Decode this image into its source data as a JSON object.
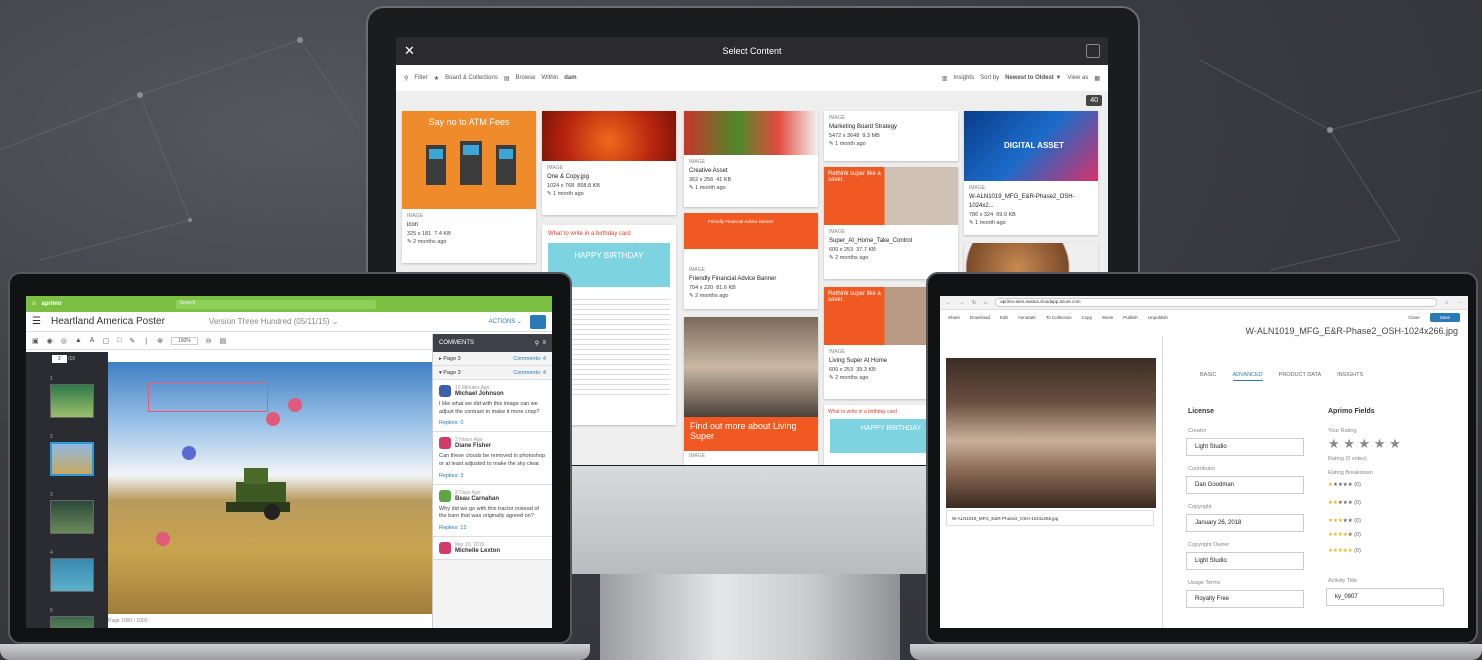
{
  "monitor": {
    "title": "Select Content",
    "close": "✕",
    "toolbar": {
      "filter": "Filter",
      "boards": "Board & Collections",
      "browse": "Browse",
      "within_label": "Within",
      "within": "dam",
      "insights": "Insights",
      "sort_label": "Sort by",
      "sort_value": "Newest to Oldest ▼",
      "view": "View as"
    },
    "count": "40",
    "cards": [
      {
        "banner": "Say no to ATM Fees",
        "type": "IMAGE",
        "name": "icon",
        "dims": "325 x 181",
        "size": "7.4 KB",
        "age": "2 months ago"
      },
      {
        "type": "IMAGE",
        "name": "One & Copy.jpg",
        "dims": "1024 x 768",
        "size": "858.8 KB",
        "age": "1 month ago"
      },
      {
        "type": "IMAGE",
        "name": "Creative Asset",
        "dims": "362 x 256",
        "size": "41 KB",
        "age": "1 month ago"
      },
      {
        "type": "IMAGE",
        "name": "Marketing Board Strategy",
        "dims": "5472 x 3648",
        "size": "9.3 MB",
        "age": "1 month ago"
      },
      {
        "banner": "DIGITAL ASSET",
        "type": "IMAGE",
        "name": "W-ALN1019_MFG_E&R-Phase2_OSH-1024x2...",
        "dims": "786 x 324",
        "size": "69.9 KB",
        "age": "1 month ago"
      },
      {
        "banner": "What to write in a birthday card",
        "name": "HAPPY BIRTHDAY"
      },
      {
        "banner": "Friendly Financial Advice Banner",
        "type": "IMAGE",
        "name": "Friendly Financial Advice Banner",
        "dims": "704 x 220",
        "size": "81.6 KB",
        "age": "2 months ago"
      },
      {
        "banner": "Rethink super like a saver.",
        "type": "IMAGE",
        "name": "Super_At_Home_Take_Control",
        "dims": "600 x 253",
        "size": "37.7 KB",
        "age": "2 months ago"
      },
      {
        "banner": "Find out more about Living Super",
        "type": "IMAGE"
      },
      {
        "banner": "Rethink super like a saver.",
        "type": "IMAGE",
        "name": "Living Super At Home",
        "dims": "600 x 253",
        "size": "39.3 KB",
        "age": "2 months ago"
      },
      {
        "banner": "What to write in a birthday card",
        "name": "HAPPY BIRTHDAY"
      }
    ]
  },
  "left": {
    "brand": "aprimo",
    "search": "Search",
    "title": "Heartland America Poster",
    "version": "Version Three Hundred (05/11/15) ⌄",
    "actions": "ACTIONS ⌄",
    "zoom": "100%",
    "page_input": "2",
    "page_total": "/10",
    "footer": "Page 1000 / 1000",
    "thumb_nums": [
      "1",
      "2",
      "3",
      "4",
      "5"
    ],
    "comments_title": "COMMENTS",
    "pages": [
      {
        "label": "Page 3",
        "count": "Comments: 4"
      },
      {
        "label": "Page 3",
        "count": "Comments: 4"
      }
    ],
    "comments": [
      {
        "time": "10 Minutes Ago",
        "name": "Michael Johnson",
        "text": "I like what we did with this image can we adjust the contrast to make it more crisp?",
        "replies": "Replies: 0",
        "color": "#3e5ea8"
      },
      {
        "time": "2 Hours Ago",
        "name": "Diane Fisher",
        "text": "Can these clouds be removed in photoshop or at least adjusted to make the sky clear.",
        "replies": "Replies: 3",
        "color": "#d23a6a"
      },
      {
        "time": "2 Days Ago",
        "name": "Beau Carnahan",
        "text": "Why did we go with this tractor instead of the barn that was originally agreed on?",
        "replies": "Replies: 12",
        "color": "#59a842"
      },
      {
        "time": "Mar 23, 2016",
        "name": "Michelle Lexton",
        "color": "#d23a6a"
      }
    ]
  },
  "right": {
    "url": "aprimo-aem.eastus.cloudapp.azure.com",
    "actions": [
      "Share",
      "Download",
      "Edit",
      "Annotate",
      "To Collection",
      "Copy",
      "Move",
      "Publish",
      "Unpublish"
    ],
    "close": "Close",
    "save": "Save",
    "filename": "W-ALN1019_MFG_E&R-Phase2_OSH-1024x266.jpg",
    "caption": "W-ALN1019_MFG_E&R-Phase2_OSH-1024x266.jpg",
    "tabs": [
      "BASIC",
      "ADVANCED",
      "PRODUCT DATA",
      "INSIGHTS"
    ],
    "license": {
      "heading": "License",
      "fields": [
        {
          "label": "Creator",
          "value": "Light Studio"
        },
        {
          "label": "Contributor",
          "value": "Dan Goodman"
        },
        {
          "label": "Copyright",
          "value": "January 26, 2018"
        },
        {
          "label": "Copyright Owner",
          "value": "Light Studio"
        },
        {
          "label": "Usage Terms",
          "value": "Royalty Free"
        }
      ]
    },
    "aprimo": {
      "heading": "Aprimo Fields",
      "your_rating": "Your Rating",
      "stars": "★ ★ ★ ★ ★",
      "rating_votes": "Rating (0 votes)",
      "breakdown": "Rating Breakdown",
      "rows": [
        "(0)",
        "(0)",
        "(0)",
        "(0)",
        "(0)"
      ],
      "activity_label": "Activity Title",
      "activity_value": "ky_0907"
    }
  }
}
